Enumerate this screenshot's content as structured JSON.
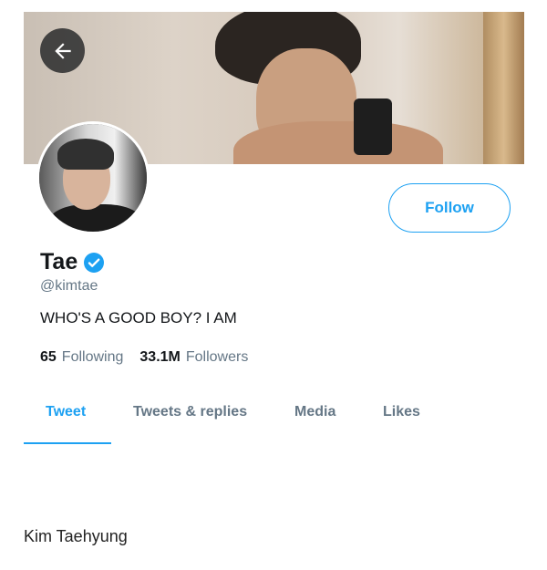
{
  "profile": {
    "name": "Tae",
    "handle": "@kimtae",
    "bio": "WHO'S A GOOD BOY? I AM",
    "verified": true
  },
  "actions": {
    "follow_label": "Follow"
  },
  "stats": {
    "following_count": "65",
    "following_label": "Following",
    "followers_count": "33.1M",
    "followers_label": "Followers"
  },
  "tabs": [
    {
      "label": "Tweet",
      "active": true
    },
    {
      "label": "Tweets & replies",
      "active": false
    },
    {
      "label": "Media",
      "active": false
    },
    {
      "label": "Likes",
      "active": false
    }
  ],
  "caption": "Kim Taehyung",
  "colors": {
    "accent": "#1da1f2",
    "secondary_text": "#657786",
    "primary_text": "#14171a"
  },
  "icons": {
    "back": "arrow-left-icon",
    "verified": "verified-badge-icon"
  }
}
